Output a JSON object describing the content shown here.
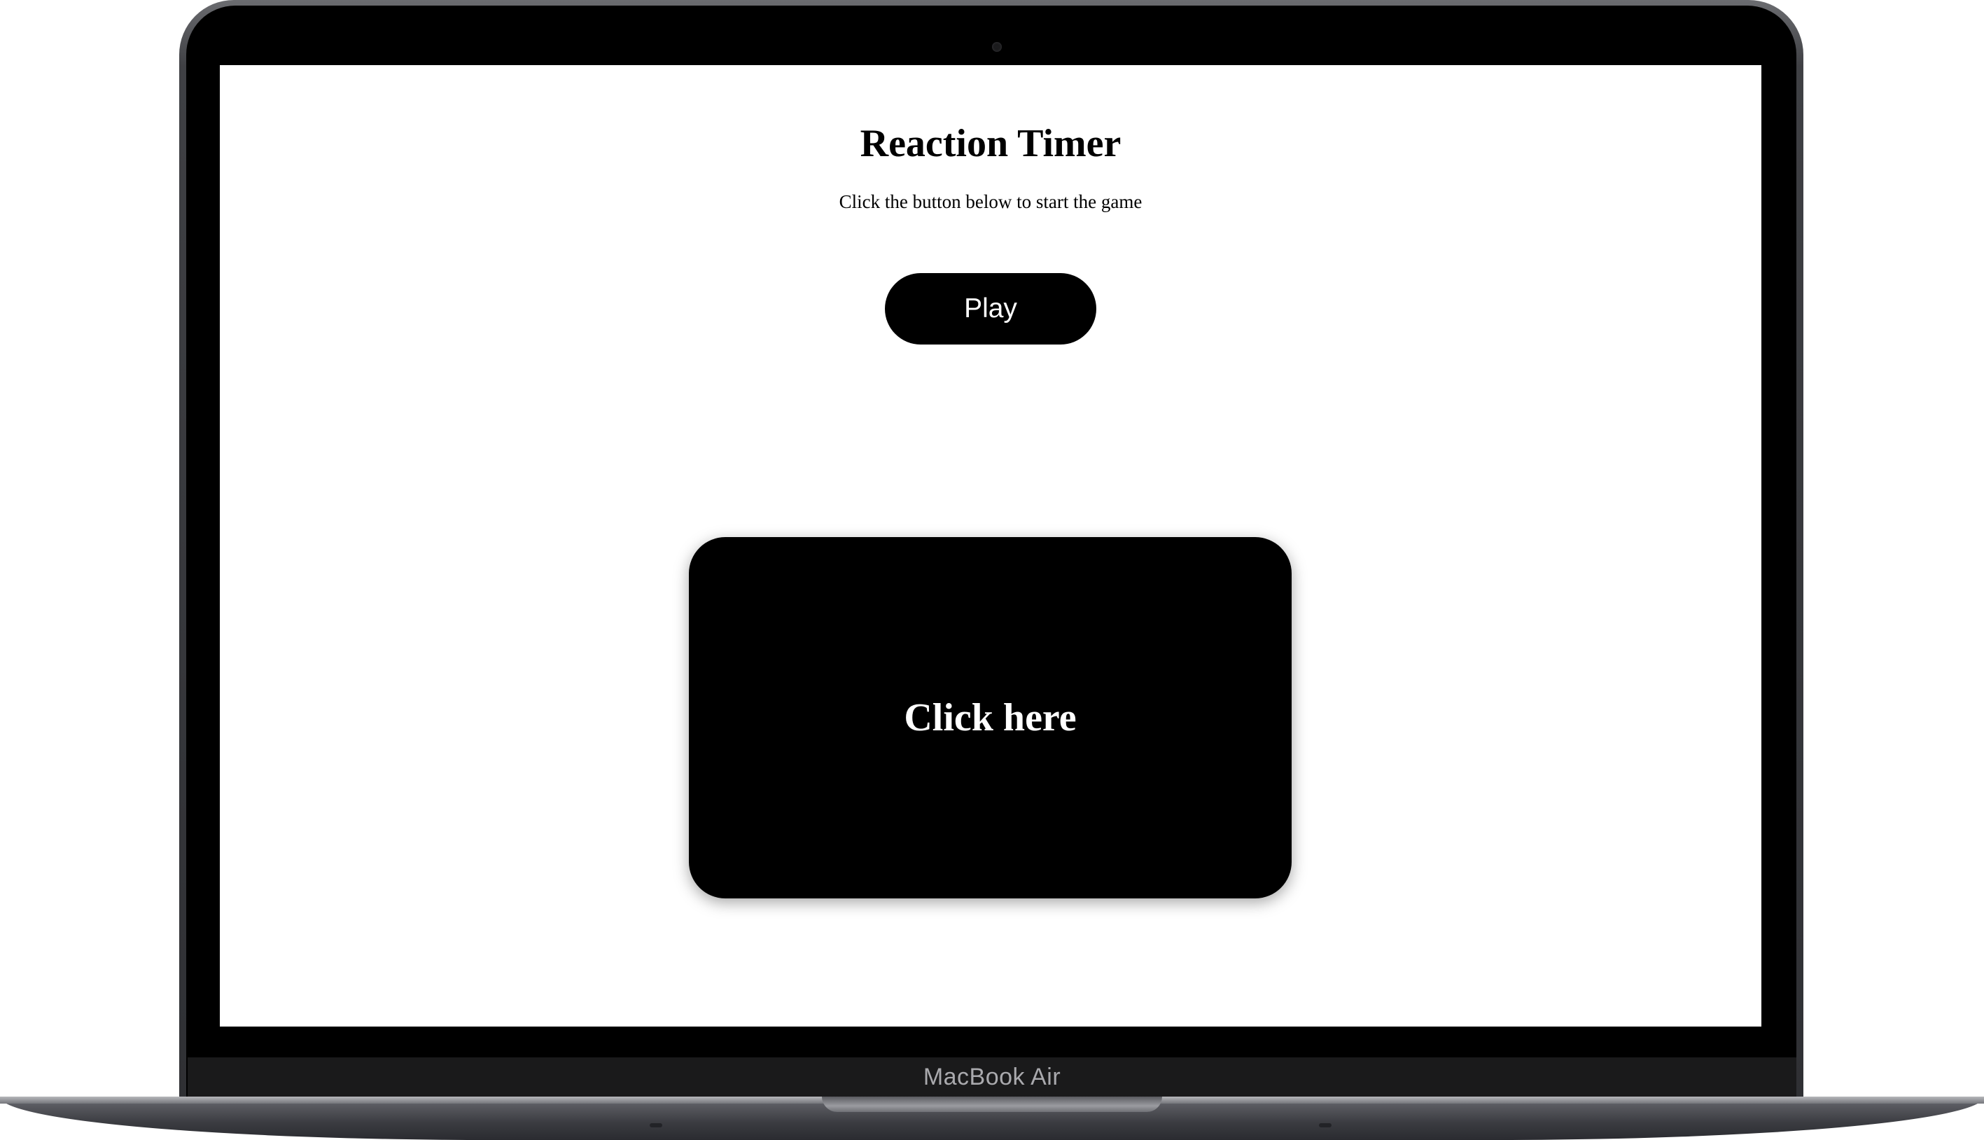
{
  "device": {
    "brand_label": "MacBook Air"
  },
  "app": {
    "title": "Reaction Timer",
    "subtitle": "Click the button below to start the game",
    "play_label": "Play",
    "click_area_label": "Click here"
  },
  "colors": {
    "background": "#ffffff",
    "button": "#000000",
    "button_text": "#ffffff",
    "text": "#000000"
  }
}
